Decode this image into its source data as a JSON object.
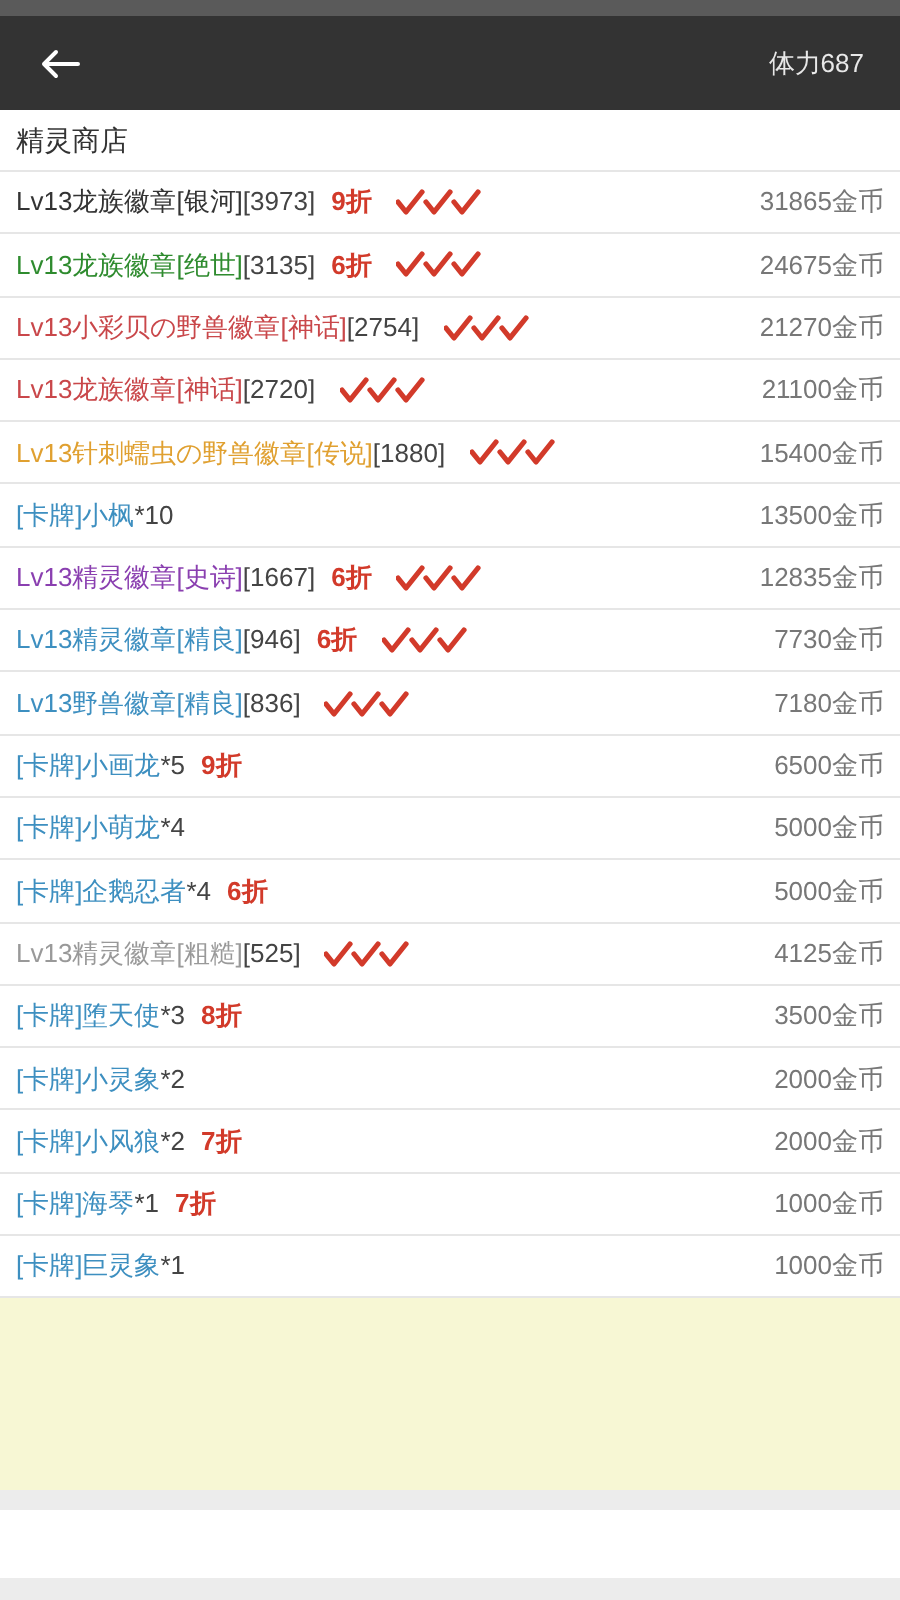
{
  "header": {
    "stamina": "体力687"
  },
  "shop": {
    "title": "精灵商店",
    "items": [
      {
        "name": "Lv13龙族徽章[银河]",
        "color": "#333333",
        "suffix": "[3973]",
        "discount": "9折",
        "checkmarks": true,
        "price": "31865金币"
      },
      {
        "name": "Lv13龙族徽章[绝世]",
        "color": "#2e8b2e",
        "suffix": "[3135]",
        "discount": "6折",
        "checkmarks": true,
        "price": "24675金币"
      },
      {
        "name": "Lv13小彩贝の野兽徽章[神话]",
        "color": "#c9474a",
        "suffix": "[2754]",
        "checkmarks": true,
        "price": "21270金币"
      },
      {
        "name": "Lv13龙族徽章[神话]",
        "color": "#c9474a",
        "suffix": "[2720]",
        "checkmarks": true,
        "price": "21100金币"
      },
      {
        "name": "Lv13针刺蠕虫の野兽徽章[传说]",
        "color": "#e0a030",
        "suffix": "[1880]",
        "checkmarks": true,
        "price": "15400金币"
      },
      {
        "name": "[卡牌]小枫",
        "color": "#3d8fc0",
        "suffix": "*10",
        "checkmarks": false,
        "price": "13500金币"
      },
      {
        "name": "Lv13精灵徽章[史诗]",
        "color": "#8a3fb0",
        "suffix": "[1667]",
        "discount": "6折",
        "checkmarks": true,
        "price": "12835金币"
      },
      {
        "name": "Lv13精灵徽章[精良]",
        "color": "#3d8fc0",
        "suffix": "[946]",
        "discount": "6折",
        "checkmarks": true,
        "price": "7730金币"
      },
      {
        "name": "Lv13野兽徽章[精良]",
        "color": "#3d8fc0",
        "suffix": "[836]",
        "checkmarks": true,
        "price": "7180金币"
      },
      {
        "name": "[卡牌]小画龙",
        "color": "#3d8fc0",
        "suffix": "*5",
        "discount": "9折",
        "checkmarks": false,
        "price": "6500金币"
      },
      {
        "name": "[卡牌]小萌龙",
        "color": "#3d8fc0",
        "suffix": "*4",
        "checkmarks": false,
        "price": "5000金币"
      },
      {
        "name": "[卡牌]企鹅忍者",
        "color": "#3d8fc0",
        "suffix": "*4",
        "discount": "6折",
        "checkmarks": false,
        "price": "5000金币"
      },
      {
        "name": "Lv13精灵徽章[粗糙]",
        "color": "#999999",
        "suffix": "[525]",
        "checkmarks": true,
        "price": "4125金币"
      },
      {
        "name": "[卡牌]堕天使",
        "color": "#3d8fc0",
        "suffix": "*3",
        "discount": "8折",
        "checkmarks": false,
        "price": "3500金币"
      },
      {
        "name": "[卡牌]小灵象",
        "color": "#3d8fc0",
        "suffix": "*2",
        "checkmarks": false,
        "price": "2000金币"
      },
      {
        "name": "[卡牌]小风狼",
        "color": "#3d8fc0",
        "suffix": "*2",
        "discount": "7折",
        "checkmarks": false,
        "price": "2000金币"
      },
      {
        "name": "[卡牌]海琴",
        "color": "#3d8fc0",
        "suffix": "*1",
        "discount": "7折",
        "checkmarks": false,
        "price": "1000金币"
      },
      {
        "name": "[卡牌]巨灵象",
        "color": "#3d8fc0",
        "suffix": "*1",
        "checkmarks": false,
        "price": "1000金币"
      }
    ]
  }
}
